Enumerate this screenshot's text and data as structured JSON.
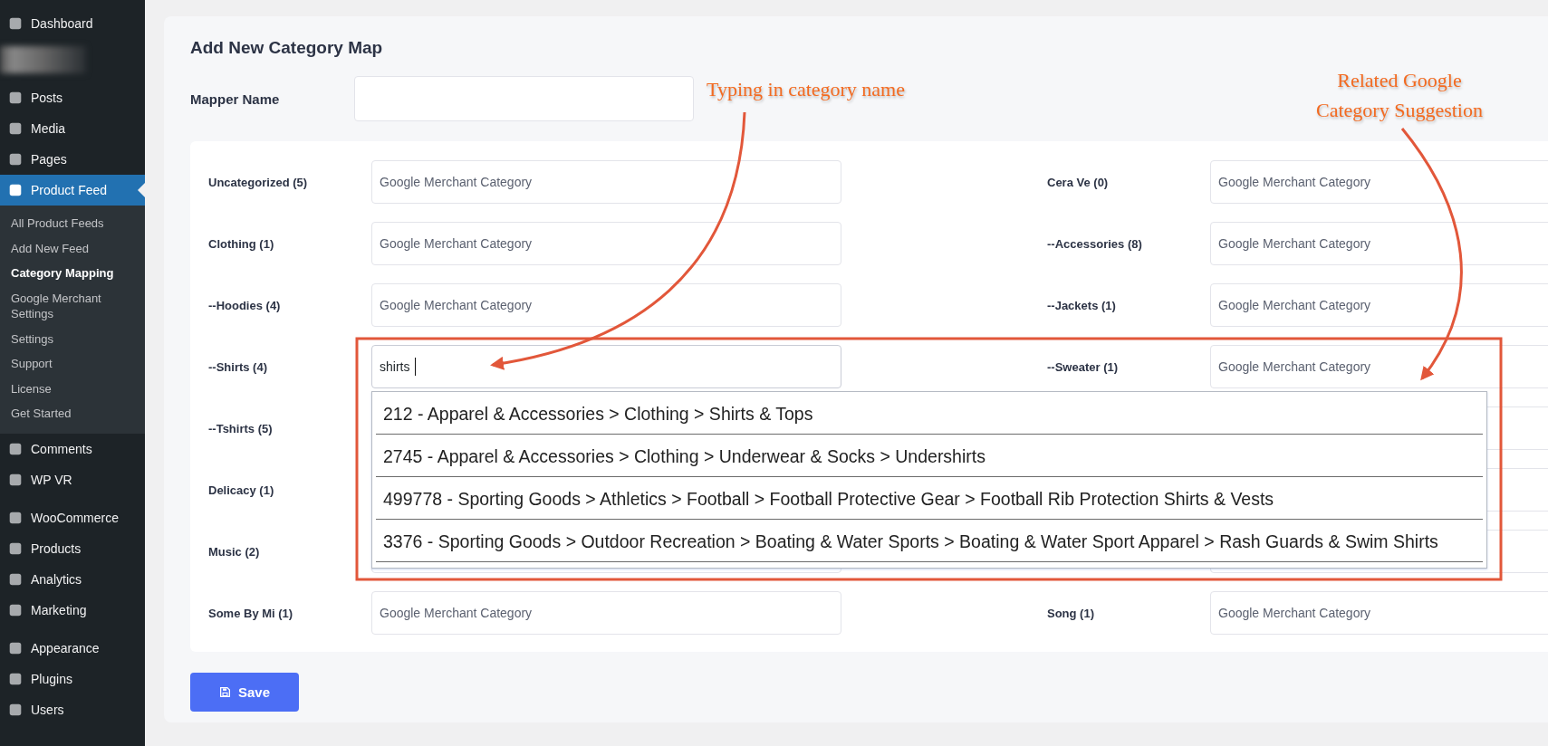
{
  "sidebar": {
    "groups": [
      [
        {
          "kind": "link",
          "label": "Dashboard",
          "selected": false
        }
      ],
      [
        {
          "kind": "blurred"
        },
        {
          "kind": "link",
          "label": "Posts",
          "selected": false
        },
        {
          "kind": "link",
          "label": "Media",
          "selected": false
        },
        {
          "kind": "link",
          "label": "Pages",
          "selected": false
        },
        {
          "kind": "link",
          "label": "Product Feed",
          "selected": true,
          "children": [
            {
              "label": "All Product Feeds",
              "selected": false
            },
            {
              "label": "Add New Feed",
              "selected": false
            },
            {
              "label": "Category Mapping",
              "selected": true
            },
            {
              "label": "Google Merchant Settings",
              "selected": false
            },
            {
              "label": "Settings",
              "selected": false
            },
            {
              "label": "Support",
              "selected": false
            },
            {
              "label": "License",
              "selected": false
            },
            {
              "label": "Get Started",
              "selected": false
            }
          ]
        },
        {
          "kind": "link",
          "label": "Comments",
          "selected": false
        },
        {
          "kind": "link",
          "label": "WP VR",
          "selected": false
        }
      ],
      [
        {
          "kind": "link",
          "label": "WooCommerce",
          "selected": false
        },
        {
          "kind": "link",
          "label": "Products",
          "selected": false
        },
        {
          "kind": "link",
          "label": "Analytics",
          "selected": false
        },
        {
          "kind": "link",
          "label": "Marketing",
          "selected": false
        }
      ],
      [
        {
          "kind": "link",
          "label": "Appearance",
          "selected": false
        },
        {
          "kind": "link",
          "label": "Plugins",
          "selected": false
        },
        {
          "kind": "link",
          "label": "Users",
          "selected": false
        }
      ]
    ]
  },
  "page": {
    "title": "Add New Category Map",
    "mapper_name": {
      "label": "Mapper Name"
    },
    "rows": [
      {
        "left": {
          "label": "Uncategorized (5)",
          "placeholder": "Google Merchant Category"
        },
        "right": {
          "label": "Cera Ve (0)",
          "placeholder": "Google Merchant Category"
        }
      },
      {
        "left": {
          "label": "Clothing (1)",
          "placeholder": "Google Merchant Category"
        },
        "right": {
          "label": "--Accessories (8)",
          "placeholder": "Google Merchant Category"
        }
      },
      {
        "left": {
          "label": "--Hoodies (4)",
          "placeholder": "Google Merchant Category"
        },
        "right": {
          "label": "--Jackets (1)",
          "placeholder": "Google Merchant Category"
        }
      },
      {
        "left": {
          "label": "--Shirts (4)",
          "value": "shirts",
          "focused": true,
          "suggestions": [
            "212 - Apparel & Accessories > Clothing > Shirts & Tops",
            "2745 - Apparel & Accessories > Clothing > Underwear & Socks > Undershirts",
            "499778 - Sporting Goods > Athletics > Football > Football Protective Gear > Football Rib Protection Shirts & Vests",
            "3376 - Sporting Goods > Outdoor Recreation > Boating & Water Sports > Boating & Water Sport Apparel > Rash Guards & Swim Shirts"
          ]
        },
        "right": {
          "label": "--Sweater (1)",
          "placeholder": "Google Merchant Category"
        }
      },
      {
        "left": {
          "label": "--Tshirts (5)"
        },
        "right": null
      },
      {
        "left": {
          "label": "Delicacy (1)"
        },
        "right": null
      },
      {
        "left": {
          "label": "Music (2)"
        },
        "right": null
      },
      {
        "left": {
          "label": "Some By Mi (1)",
          "placeholder": "Google Merchant Category"
        },
        "right": {
          "label": "Song (1)",
          "placeholder": "Google Merchant Category"
        }
      }
    ],
    "save_button": "Save"
  },
  "annotations": [
    {
      "text": "Typing in category name"
    },
    {
      "text": "Related Google Category Suggestion"
    }
  ]
}
